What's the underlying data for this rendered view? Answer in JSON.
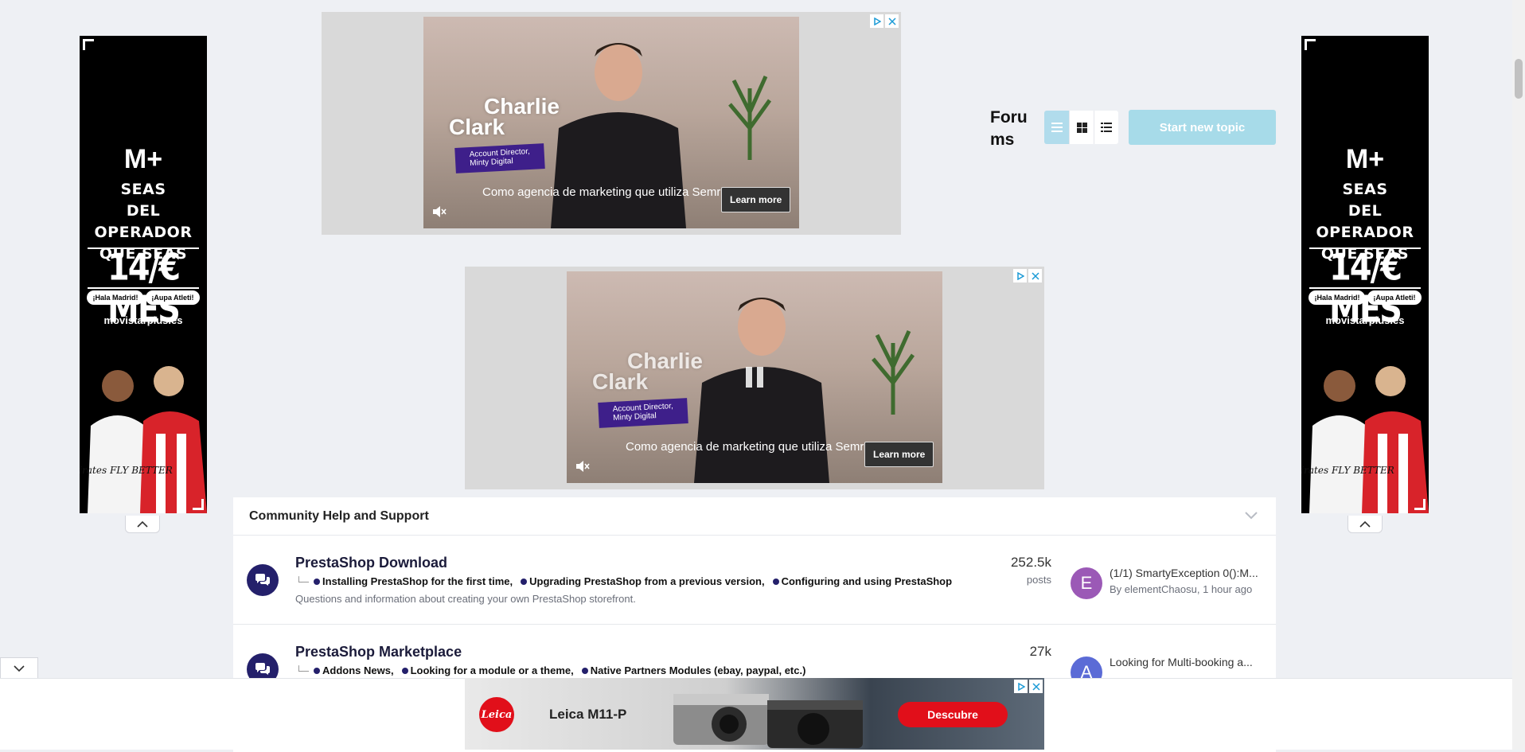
{
  "side_ad": {
    "brand": "M+",
    "lines": [
      "SEAS",
      "DEL OPERADOR",
      "QUE SEAS"
    ],
    "price": "14/€ MES",
    "pill_left": "¡Hala Madrid!",
    "pill_right": "¡Aupa Atleti!",
    "site": "movistarplus.es",
    "sponsor_text": "Emirates FLY BETTER"
  },
  "video_ad": {
    "name_line1": "Charlie",
    "name_line2": "Clark",
    "role_line1": "Account Director,",
    "role_line2": "Minty Digital",
    "caption": "Como agencia de marketing que utiliza Semrush",
    "cta": "Learn more"
  },
  "forums": {
    "title_line1": "Foru",
    "title_line2": "ms",
    "start_topic_label": "Start new topic"
  },
  "section": {
    "title": "Community Help and Support"
  },
  "forum_rows": [
    {
      "title": "PrestaShop Download",
      "subforums": [
        "Installing PrestaShop for the first time,",
        "Upgrading PrestaShop from a previous version,",
        "Configuring and using PrestaShop"
      ],
      "description": "Questions and information about creating your own PrestaShop storefront.",
      "count": "252.5k",
      "count_label": "posts",
      "avatar_letter": "E",
      "avatar_color": "#9b59b6",
      "last_title": "(1/1) SmartyException 0():M...",
      "last_by": "By elementChaosu, 1 hour ago"
    },
    {
      "title": "PrestaShop Marketplace",
      "subforums": [
        "Addons News,",
        "Looking for a module or a theme,",
        "Native Partners Modules (ebay, paypal, etc.)"
      ],
      "count": "27k",
      "avatar_letter": "A",
      "avatar_color": "#5b6bd6",
      "last_title": "Looking for Multi-booking a..."
    }
  ],
  "leica_ad": {
    "logo": "Leica",
    "model": "Leica M11-P",
    "cta": "Descubre"
  },
  "colors": {
    "accent": "#24206b",
    "start_topic_bg": "#a7dbe9",
    "leica_red": "#e10f1a"
  }
}
